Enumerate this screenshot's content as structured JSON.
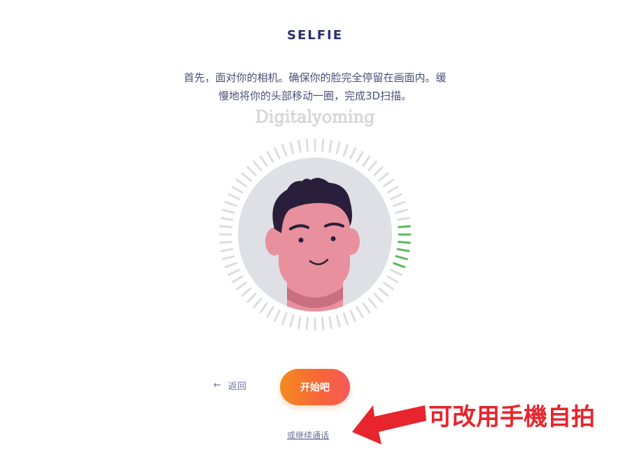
{
  "header": {
    "title": "SELFIE"
  },
  "instructions": {
    "line1": "首先，面对你的相机。确保你的脸完全停留在画面内。缓",
    "line2": "慢地将你的头部移动一圈，完成3D扫描。"
  },
  "watermark": "Digitalyoming",
  "scan": {
    "progress_color": "#5cb85c",
    "tick_color": "#dcdde2",
    "face_bg": "#dfe0e5"
  },
  "actions": {
    "back_label": "返回",
    "start_label": "开始吧",
    "phone_link": "或继续通话"
  },
  "annotation": {
    "text": "可改用手機自拍",
    "color": "#e8242c"
  }
}
